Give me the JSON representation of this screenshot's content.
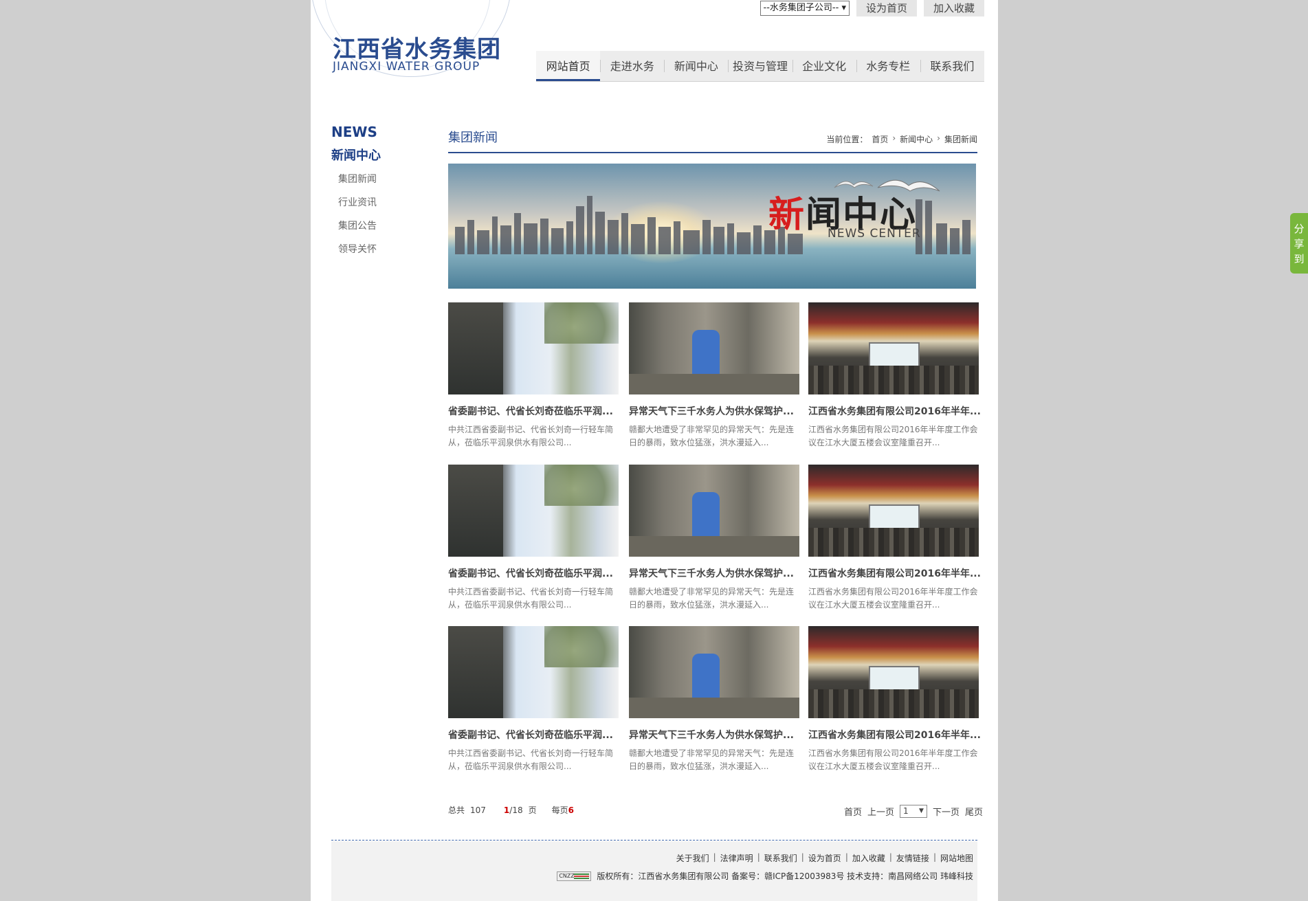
{
  "header": {
    "logo_cn": "江西省水务集团",
    "logo_en": "JIANGXI WATER GROUP",
    "subsidiary_select": "--水务集团子公司--",
    "set_home": "设为首页",
    "add_favorite": "加入收藏"
  },
  "nav": {
    "items": [
      {
        "label": "网站首页"
      },
      {
        "label": "走进水务"
      },
      {
        "label": "新闻中心"
      },
      {
        "label": "投资与管理"
      },
      {
        "label": "企业文化"
      },
      {
        "label": "水务专栏"
      },
      {
        "label": "联系我们"
      }
    ],
    "active_index": 0
  },
  "sidebar": {
    "title_en": "NEWS",
    "title_cn": "新闻中心",
    "items": [
      {
        "label": "集团新闻"
      },
      {
        "label": "行业资讯"
      },
      {
        "label": "集团公告"
      },
      {
        "label": "领导关怀"
      }
    ]
  },
  "main": {
    "title": "集团新闻",
    "breadcrumb_prefix": "当前位置：",
    "breadcrumb": [
      "首页",
      "新闻中心",
      "集团新闻"
    ],
    "banner_red": "新",
    "banner_rest": "闻中心",
    "banner_en": "NEWS CENTER"
  },
  "news": [
    {
      "title": "省委副书记、代省长刘奇莅临乐平润...",
      "desc": "中共江西省委副书记、代省长刘奇一行轻车简从，莅临乐平润泉供水有限公司...",
      "image": "officials-photo"
    },
    {
      "title": "异常天气下三千水务人为供水保驾护...",
      "desc": "赣鄱大地遭受了非常罕见的异常天气：先是连日的暴雨，致水位猛涨，洪水漫延入...",
      "image": "workers-photo"
    },
    {
      "title": "江西省水务集团有限公司2016年半年...",
      "desc": "江西省水务集团有限公司2016年半年度工作会议在江水大厦五楼会议室隆重召开...",
      "image": "meeting-photo"
    },
    {
      "title": "省委副书记、代省长刘奇莅临乐平润...",
      "desc": "中共江西省委副书记、代省长刘奇一行轻车简从，莅临乐平润泉供水有限公司...",
      "image": "officials-photo"
    },
    {
      "title": "异常天气下三千水务人为供水保驾护...",
      "desc": "赣鄱大地遭受了非常罕见的异常天气：先是连日的暴雨，致水位猛涨，洪水漫延入...",
      "image": "workers-photo"
    },
    {
      "title": "江西省水务集团有限公司2016年半年...",
      "desc": "江西省水务集团有限公司2016年半年度工作会议在江水大厦五楼会议室隆重召开...",
      "image": "meeting-photo"
    },
    {
      "title": "省委副书记、代省长刘奇莅临乐平润...",
      "desc": "中共江西省委副书记、代省长刘奇一行轻车简从，莅临乐平润泉供水有限公司...",
      "image": "officials-photo"
    },
    {
      "title": "异常天气下三千水务人为供水保驾护...",
      "desc": "赣鄱大地遭受了非常罕见的异常天气：先是连日的暴雨，致水位猛涨，洪水漫延入...",
      "image": "workers-photo"
    },
    {
      "title": "江西省水务集团有限公司2016年半年...",
      "desc": "江西省水务集团有限公司2016年半年度工作会议在江水大厦五楼会议室隆重召开...",
      "image": "meeting-photo"
    }
  ],
  "pager": {
    "total_label": "总共",
    "total": "107",
    "current": "1",
    "pages": "/18",
    "page_unit": "页",
    "per_page_label": "每页",
    "per_page": "6",
    "first": "首页",
    "prev": "上一页",
    "select_value": "1",
    "next": "下一页",
    "last": "尾页"
  },
  "footer": {
    "links": [
      "关于我们",
      "法律声明",
      "联系我们",
      "设为首页",
      "加入收藏",
      "友情链接",
      "网站地图"
    ],
    "cnzz": "CNZZ",
    "copyright": "版权所有：江西省水务集团有限公司 备案号：赣ICP备12003983号 技术支持：南昌网络公司 玮峰科技"
  },
  "share": {
    "label": "分享到"
  },
  "colors": {
    "brand": "#2a4c8f",
    "share_green": "#79b73c",
    "accent_red": "#d71d1d"
  }
}
